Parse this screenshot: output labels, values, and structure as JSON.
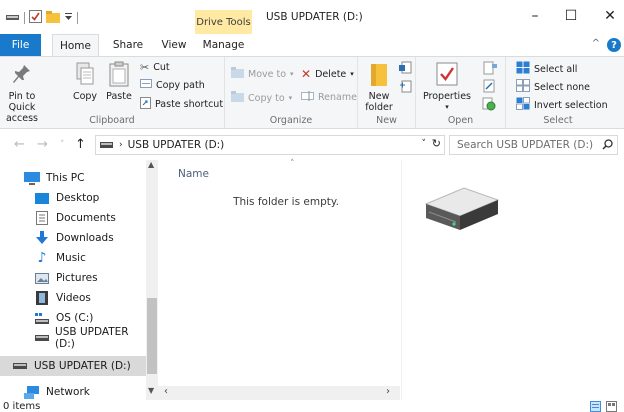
{
  "window": {
    "title": "USB UPDATER (D:)",
    "context_tab_header": "Drive Tools",
    "controls": {
      "minimize": "–",
      "maximize": "☐",
      "close": "✕"
    }
  },
  "tabs": [
    {
      "label": "File"
    },
    {
      "label": "Home"
    },
    {
      "label": "Share"
    },
    {
      "label": "View"
    },
    {
      "label": "Manage"
    }
  ],
  "ribbon": {
    "clipboard": {
      "label": "Clipboard",
      "pin": "Pin to Quick access",
      "copy": "Copy",
      "paste": "Paste",
      "cut": "Cut",
      "copy_path": "Copy path",
      "paste_shortcut": "Paste shortcut"
    },
    "organize": {
      "label": "Organize",
      "move_to": "Move to",
      "copy_to": "Copy to",
      "delete": "Delete",
      "rename": "Rename"
    },
    "new": {
      "label": "New",
      "new_folder": "New folder"
    },
    "open": {
      "label": "Open",
      "properties": "Properties"
    },
    "select": {
      "label": "Select",
      "select_all": "Select all",
      "select_none": "Select none",
      "invert": "Invert selection"
    }
  },
  "address": {
    "path": "USB UPDATER (D:)",
    "search_placeholder": "Search USB UPDATER (D:)"
  },
  "nav": {
    "items": [
      {
        "label": "This PC",
        "icon": "pc-icon"
      },
      {
        "label": "Desktop",
        "icon": "desktop-icon"
      },
      {
        "label": "Documents",
        "icon": "documents-icon"
      },
      {
        "label": "Downloads",
        "icon": "downloads-icon"
      },
      {
        "label": "Music",
        "icon": "music-icon"
      },
      {
        "label": "Pictures",
        "icon": "pictures-icon"
      },
      {
        "label": "Videos",
        "icon": "videos-icon"
      },
      {
        "label": "OS (C:)",
        "icon": "os-drive-icon"
      },
      {
        "label": "USB UPDATER (D:)",
        "icon": "usb-drive-icon"
      },
      {
        "label": "USB UPDATER (D:)",
        "icon": "usb-drive-icon",
        "selected": true
      },
      {
        "label": "Network",
        "icon": "network-icon"
      }
    ]
  },
  "content": {
    "column_name": "Name",
    "empty_message": "This folder is empty."
  },
  "status": {
    "items": "0 items"
  },
  "colors": {
    "accent": "#1979ca",
    "drive_tools": "#ffe9a3",
    "ribbon_bg": "#f5f6f7",
    "selected_nav": "#d9d9d9"
  }
}
